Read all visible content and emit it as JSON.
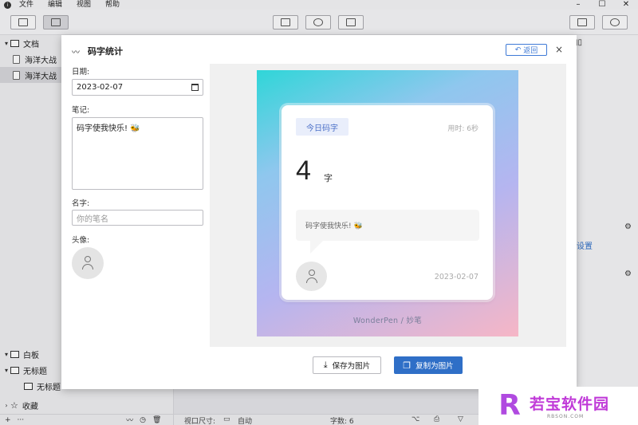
{
  "menubar": {
    "items": [
      "文件",
      "编辑",
      "视图",
      "帮助"
    ]
  },
  "sidebar": {
    "section_docs": "文档",
    "doc_items": [
      "海洋大战",
      "海洋大战"
    ],
    "section_whiteboard": "白板",
    "whiteboard_items": [
      "无标题",
      "无标题"
    ],
    "section_favorites": "收藏"
  },
  "status": {
    "viewport_label": "视口尺寸:",
    "viewport_value": "自动",
    "word_count": "字数: 6"
  },
  "right_panel": {
    "settings_text": "设置"
  },
  "watermark": {
    "title": "若宝软件园",
    "sub": "RBSON.COM"
  },
  "modal": {
    "title": "码字统计",
    "back_label": "返回",
    "form": {
      "date_label": "日期:",
      "date_value": "2023-02-07",
      "note_label": "笔记:",
      "note_value": "码字使我快乐! 🐝",
      "name_label": "名字:",
      "name_placeholder": "你的笔名",
      "avatar_label": "头像:"
    },
    "card": {
      "badge": "今日码字",
      "time_used": "用时: 6秒",
      "count": "4",
      "unit": "字",
      "note": "码字使我快乐! 🐝",
      "date": "2023-02-07",
      "brand": "WonderPen / 妙笔"
    },
    "save_label": "保存为图片",
    "copy_label": "复制为图片"
  },
  "colors": {
    "accent": "#2f6fc7",
    "badge_bg": "#e9eefb"
  }
}
